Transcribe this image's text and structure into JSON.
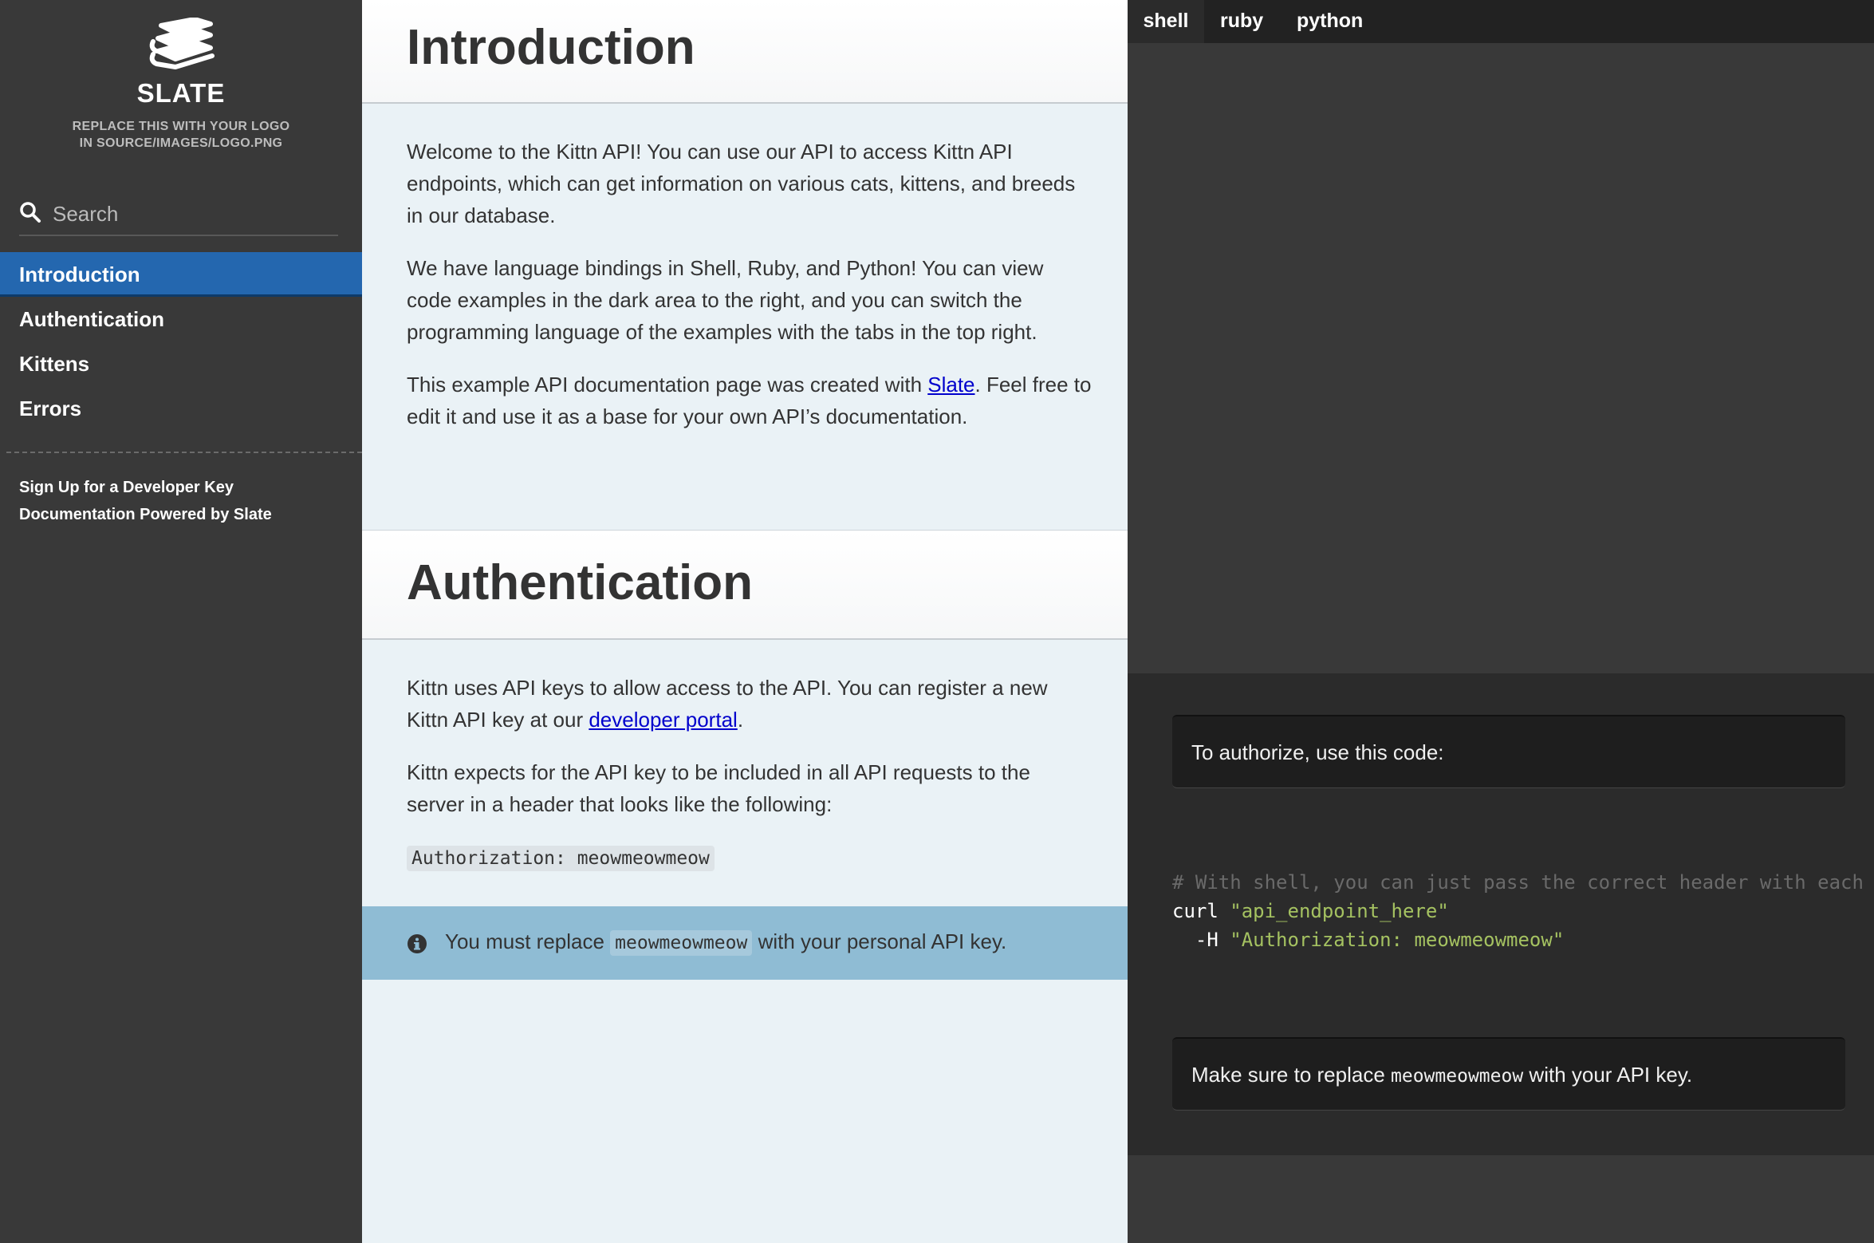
{
  "sidebar": {
    "logo_title": "SLATE",
    "logo_sub_line1": "REPLACE THIS WITH YOUR LOGO",
    "logo_sub_line2": "IN SOURCE/IMAGES/LOGO.PNG",
    "search_placeholder": "Search",
    "toc": [
      {
        "label": "Introduction",
        "active": true
      },
      {
        "label": "Authentication",
        "active": false
      },
      {
        "label": "Kittens",
        "active": false
      },
      {
        "label": "Errors",
        "active": false
      }
    ],
    "footer_links": [
      "Sign Up for a Developer Key",
      "Documentation Powered by Slate"
    ]
  },
  "content": {
    "intro": {
      "title": "Introduction",
      "p1": "Welcome to the Kittn API! You can use our API to access Kittn API endpoints, which can get information on various cats, kittens, and breeds in our database.",
      "p2": "We have language bindings in Shell, Ruby, and Python! You can view code examples in the dark area to the right, and you can switch the programming language of the examples with the tabs in the top right.",
      "p3_before": "This example API documentation page was created with ",
      "p3_link": "Slate",
      "p3_after": ". Feel free to edit it and use it as a base for your own API’s documentation."
    },
    "auth": {
      "title": "Authentication",
      "p1_before": "Kittn uses API keys to allow access to the API. You can register a new Kittn API key at our ",
      "p1_link": "developer portal",
      "p1_after": ".",
      "p2": "Kittn expects for the API key to be included in all API requests to the server in a header that looks like the following:",
      "header_code": "Authorization: meowmeowmeow",
      "notice_before": "You must replace ",
      "notice_code": "meowmeowmeow",
      "notice_after": " with your personal API key."
    }
  },
  "code_panel": {
    "tabs": [
      {
        "label": "shell",
        "active": true
      },
      {
        "label": "ruby",
        "active": false
      },
      {
        "label": "python",
        "active": false
      }
    ],
    "aside1": "To authorize, use this code:",
    "code_comment": "# With shell, you can just pass the correct header with each request",
    "code_cmd": "curl ",
    "code_url": "\"api_endpoint_here\"",
    "code_flag": "  -H ",
    "code_header": "\"Authorization: meowmeowmeow\"",
    "aside2_before": "Make sure to replace ",
    "aside2_code": "meowmeowmeow",
    "aside2_after": " with your API key."
  },
  "colors": {
    "sidebar_bg": "#393939",
    "active_nav": "#2467af",
    "content_bg": "#eaf2f6",
    "notice_bg": "#8fbcd4",
    "code_string": "#a5c261"
  }
}
